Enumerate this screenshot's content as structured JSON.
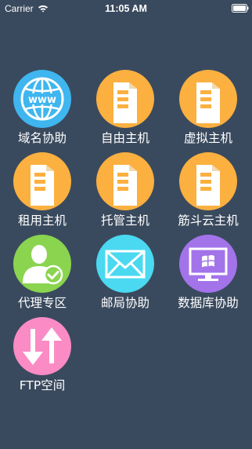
{
  "status_bar": {
    "carrier": "Carrier",
    "time": "11:05 AM"
  },
  "colors": {
    "background": "#3a4a5e",
    "blue": "#3fb6ef",
    "orange": "#fbb040",
    "green": "#8ad44f",
    "cyan": "#4ad9f0",
    "purple": "#a373ea",
    "pink": "#fb8bc4"
  },
  "tiles": [
    {
      "label": "域名协助",
      "icon": "www-globe-icon"
    },
    {
      "label": "自由主机",
      "icon": "server-icon"
    },
    {
      "label": "虚拟主机",
      "icon": "server-icon"
    },
    {
      "label": "租用主机",
      "icon": "server-icon"
    },
    {
      "label": "托管主机",
      "icon": "server-icon"
    },
    {
      "label": "筋斗云主机",
      "icon": "server-icon"
    },
    {
      "label": "代理专区",
      "icon": "agent-user-icon"
    },
    {
      "label": "邮局协助",
      "icon": "mail-envelope-icon"
    },
    {
      "label": "数据库协助",
      "icon": "monitor-windows-icon"
    },
    {
      "label": "FTP空间",
      "icon": "upload-download-arrows-icon"
    }
  ]
}
